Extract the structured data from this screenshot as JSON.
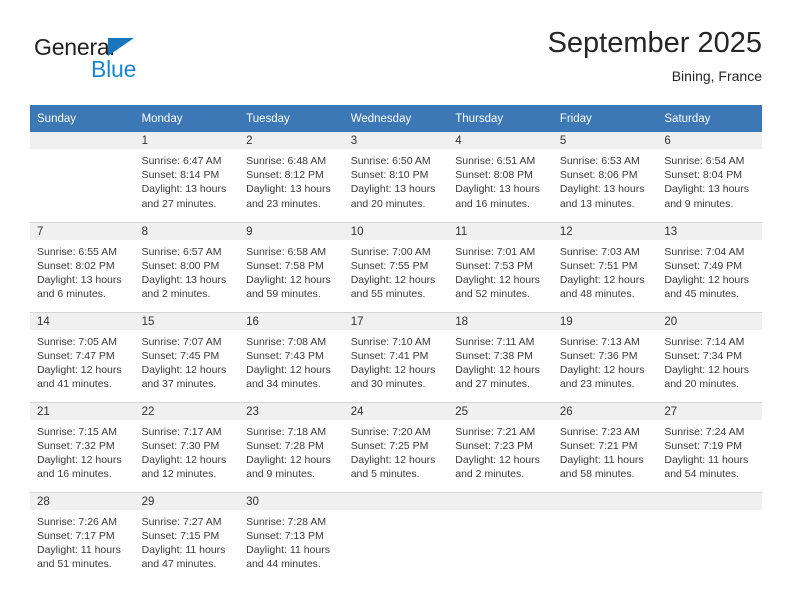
{
  "logo": {
    "primary_text": "General",
    "secondary_text": "Blue",
    "primary_color": "#231f20",
    "secondary_color": "#1b87d4",
    "triangle_color": "#1b75bb"
  },
  "header": {
    "title": "September 2025",
    "subtitle": "Bining, France"
  },
  "theme": {
    "header_bg": "#3b78b5",
    "header_text": "#ffffff",
    "day_band_bg": "#f0f0f0",
    "grid_line": "#d4d4d4"
  },
  "weekday_headers": [
    "Sunday",
    "Monday",
    "Tuesday",
    "Wednesday",
    "Thursday",
    "Friday",
    "Saturday"
  ],
  "weeks": [
    [
      {
        "day": "",
        "sunrise": "",
        "sunset": "",
        "daylight_line1": "",
        "daylight_line2": ""
      },
      {
        "day": "1",
        "sunrise": "Sunrise: 6:47 AM",
        "sunset": "Sunset: 8:14 PM",
        "daylight_line1": "Daylight: 13 hours",
        "daylight_line2": "and 27 minutes."
      },
      {
        "day": "2",
        "sunrise": "Sunrise: 6:48 AM",
        "sunset": "Sunset: 8:12 PM",
        "daylight_line1": "Daylight: 13 hours",
        "daylight_line2": "and 23 minutes."
      },
      {
        "day": "3",
        "sunrise": "Sunrise: 6:50 AM",
        "sunset": "Sunset: 8:10 PM",
        "daylight_line1": "Daylight: 13 hours",
        "daylight_line2": "and 20 minutes."
      },
      {
        "day": "4",
        "sunrise": "Sunrise: 6:51 AM",
        "sunset": "Sunset: 8:08 PM",
        "daylight_line1": "Daylight: 13 hours",
        "daylight_line2": "and 16 minutes."
      },
      {
        "day": "5",
        "sunrise": "Sunrise: 6:53 AM",
        "sunset": "Sunset: 8:06 PM",
        "daylight_line1": "Daylight: 13 hours",
        "daylight_line2": "and 13 minutes."
      },
      {
        "day": "6",
        "sunrise": "Sunrise: 6:54 AM",
        "sunset": "Sunset: 8:04 PM",
        "daylight_line1": "Daylight: 13 hours",
        "daylight_line2": "and 9 minutes."
      }
    ],
    [
      {
        "day": "7",
        "sunrise": "Sunrise: 6:55 AM",
        "sunset": "Sunset: 8:02 PM",
        "daylight_line1": "Daylight: 13 hours",
        "daylight_line2": "and 6 minutes."
      },
      {
        "day": "8",
        "sunrise": "Sunrise: 6:57 AM",
        "sunset": "Sunset: 8:00 PM",
        "daylight_line1": "Daylight: 13 hours",
        "daylight_line2": "and 2 minutes."
      },
      {
        "day": "9",
        "sunrise": "Sunrise: 6:58 AM",
        "sunset": "Sunset: 7:58 PM",
        "daylight_line1": "Daylight: 12 hours",
        "daylight_line2": "and 59 minutes."
      },
      {
        "day": "10",
        "sunrise": "Sunrise: 7:00 AM",
        "sunset": "Sunset: 7:55 PM",
        "daylight_line1": "Daylight: 12 hours",
        "daylight_line2": "and 55 minutes."
      },
      {
        "day": "11",
        "sunrise": "Sunrise: 7:01 AM",
        "sunset": "Sunset: 7:53 PM",
        "daylight_line1": "Daylight: 12 hours",
        "daylight_line2": "and 52 minutes."
      },
      {
        "day": "12",
        "sunrise": "Sunrise: 7:03 AM",
        "sunset": "Sunset: 7:51 PM",
        "daylight_line1": "Daylight: 12 hours",
        "daylight_line2": "and 48 minutes."
      },
      {
        "day": "13",
        "sunrise": "Sunrise: 7:04 AM",
        "sunset": "Sunset: 7:49 PM",
        "daylight_line1": "Daylight: 12 hours",
        "daylight_line2": "and 45 minutes."
      }
    ],
    [
      {
        "day": "14",
        "sunrise": "Sunrise: 7:05 AM",
        "sunset": "Sunset: 7:47 PM",
        "daylight_line1": "Daylight: 12 hours",
        "daylight_line2": "and 41 minutes."
      },
      {
        "day": "15",
        "sunrise": "Sunrise: 7:07 AM",
        "sunset": "Sunset: 7:45 PM",
        "daylight_line1": "Daylight: 12 hours",
        "daylight_line2": "and 37 minutes."
      },
      {
        "day": "16",
        "sunrise": "Sunrise: 7:08 AM",
        "sunset": "Sunset: 7:43 PM",
        "daylight_line1": "Daylight: 12 hours",
        "daylight_line2": "and 34 minutes."
      },
      {
        "day": "17",
        "sunrise": "Sunrise: 7:10 AM",
        "sunset": "Sunset: 7:41 PM",
        "daylight_line1": "Daylight: 12 hours",
        "daylight_line2": "and 30 minutes."
      },
      {
        "day": "18",
        "sunrise": "Sunrise: 7:11 AM",
        "sunset": "Sunset: 7:38 PM",
        "daylight_line1": "Daylight: 12 hours",
        "daylight_line2": "and 27 minutes."
      },
      {
        "day": "19",
        "sunrise": "Sunrise: 7:13 AM",
        "sunset": "Sunset: 7:36 PM",
        "daylight_line1": "Daylight: 12 hours",
        "daylight_line2": "and 23 minutes."
      },
      {
        "day": "20",
        "sunrise": "Sunrise: 7:14 AM",
        "sunset": "Sunset: 7:34 PM",
        "daylight_line1": "Daylight: 12 hours",
        "daylight_line2": "and 20 minutes."
      }
    ],
    [
      {
        "day": "21",
        "sunrise": "Sunrise: 7:15 AM",
        "sunset": "Sunset: 7:32 PM",
        "daylight_line1": "Daylight: 12 hours",
        "daylight_line2": "and 16 minutes."
      },
      {
        "day": "22",
        "sunrise": "Sunrise: 7:17 AM",
        "sunset": "Sunset: 7:30 PM",
        "daylight_line1": "Daylight: 12 hours",
        "daylight_line2": "and 12 minutes."
      },
      {
        "day": "23",
        "sunrise": "Sunrise: 7:18 AM",
        "sunset": "Sunset: 7:28 PM",
        "daylight_line1": "Daylight: 12 hours",
        "daylight_line2": "and 9 minutes."
      },
      {
        "day": "24",
        "sunrise": "Sunrise: 7:20 AM",
        "sunset": "Sunset: 7:25 PM",
        "daylight_line1": "Daylight: 12 hours",
        "daylight_line2": "and 5 minutes."
      },
      {
        "day": "25",
        "sunrise": "Sunrise: 7:21 AM",
        "sunset": "Sunset: 7:23 PM",
        "daylight_line1": "Daylight: 12 hours",
        "daylight_line2": "and 2 minutes."
      },
      {
        "day": "26",
        "sunrise": "Sunrise: 7:23 AM",
        "sunset": "Sunset: 7:21 PM",
        "daylight_line1": "Daylight: 11 hours",
        "daylight_line2": "and 58 minutes."
      },
      {
        "day": "27",
        "sunrise": "Sunrise: 7:24 AM",
        "sunset": "Sunset: 7:19 PM",
        "daylight_line1": "Daylight: 11 hours",
        "daylight_line2": "and 54 minutes."
      }
    ],
    [
      {
        "day": "28",
        "sunrise": "Sunrise: 7:26 AM",
        "sunset": "Sunset: 7:17 PM",
        "daylight_line1": "Daylight: 11 hours",
        "daylight_line2": "and 51 minutes."
      },
      {
        "day": "29",
        "sunrise": "Sunrise: 7:27 AM",
        "sunset": "Sunset: 7:15 PM",
        "daylight_line1": "Daylight: 11 hours",
        "daylight_line2": "and 47 minutes."
      },
      {
        "day": "30",
        "sunrise": "Sunrise: 7:28 AM",
        "sunset": "Sunset: 7:13 PM",
        "daylight_line1": "Daylight: 11 hours",
        "daylight_line2": "and 44 minutes."
      },
      {
        "day": "",
        "sunrise": "",
        "sunset": "",
        "daylight_line1": "",
        "daylight_line2": ""
      },
      {
        "day": "",
        "sunrise": "",
        "sunset": "",
        "daylight_line1": "",
        "daylight_line2": ""
      },
      {
        "day": "",
        "sunrise": "",
        "sunset": "",
        "daylight_line1": "",
        "daylight_line2": ""
      },
      {
        "day": "",
        "sunrise": "",
        "sunset": "",
        "daylight_line1": "",
        "daylight_line2": ""
      }
    ]
  ]
}
